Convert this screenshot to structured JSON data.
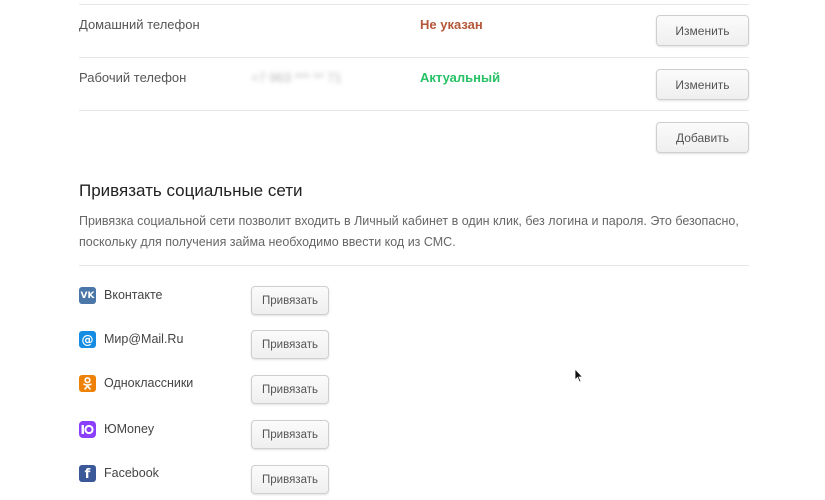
{
  "phones": [
    {
      "label": "Домашний телефон",
      "number": "",
      "status": "Не указан",
      "status_type": "bad",
      "button": "Изменить"
    },
    {
      "label": "Рабочий телефон",
      "number": "+7 963 *** ** 71",
      "status": "Актуальный",
      "status_type": "ok",
      "button": "Изменить"
    }
  ],
  "add_button": "Добавить",
  "social": {
    "title": "Привязать социальные сети",
    "description": "Привязка социальной сети позволит входить в Личный кабинет в один клик, без логина и пароля. Это безопасно, поскольку для получения займа необходимо ввести код из СМС.",
    "items": [
      {
        "name": "Вконтакте",
        "icon": "vk-icon",
        "color": "#4a76a8",
        "button": "Привязать"
      },
      {
        "name": "Мир@Mail.Ru",
        "icon": "mailru-icon",
        "color": "#168de2",
        "button": "Привязать"
      },
      {
        "name": "Одноклассники",
        "icon": "odnoklassniki-icon",
        "color": "#ee8208",
        "button": "Привязать"
      },
      {
        "name": "ЮMoney",
        "icon": "yoomoney-icon",
        "color": "#8b3ffd",
        "button": "Привязать"
      },
      {
        "name": "Facebook",
        "icon": "facebook-icon",
        "color": "#3b5998",
        "button": "Привязать"
      }
    ]
  }
}
